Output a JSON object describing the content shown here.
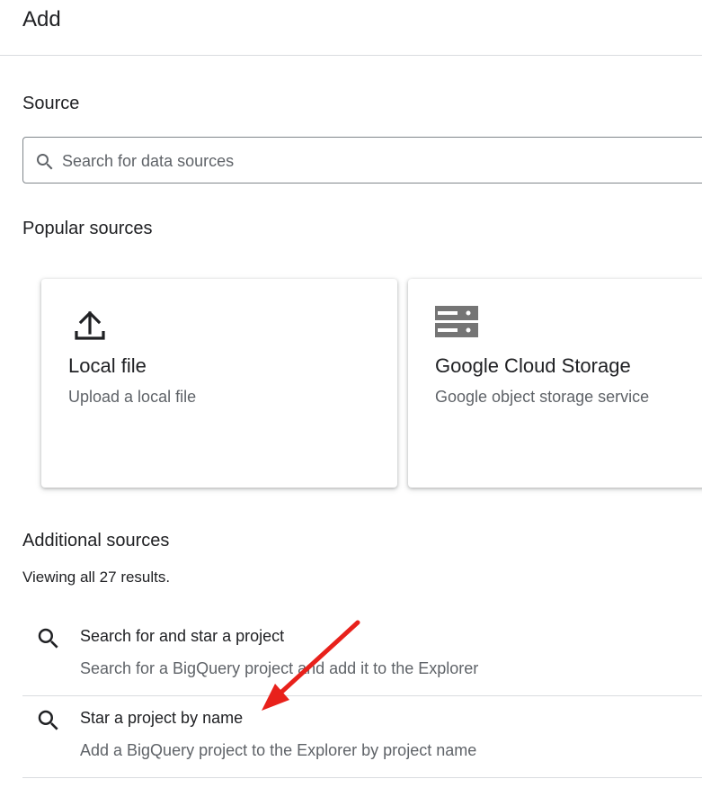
{
  "header": {
    "title": "Add"
  },
  "source": {
    "heading": "Source",
    "search": {
      "placeholder": "Search for data sources",
      "value": "",
      "icon": "search-icon"
    }
  },
  "popular": {
    "heading": "Popular sources",
    "cards": [
      {
        "icon": "upload-icon",
        "title": "Local file",
        "description": "Upload a local file"
      },
      {
        "icon": "storage-icon",
        "title": "Google Cloud Storage",
        "description": "Google object storage service"
      }
    ]
  },
  "additional": {
    "heading": "Additional sources",
    "count_text": "Viewing all 27 results.",
    "items": [
      {
        "icon": "search-icon",
        "title": "Search for and star a project",
        "description": "Search for a BigQuery project and add it to the Explorer"
      },
      {
        "icon": "search-icon",
        "title": "Star a project by name",
        "description": "Add a BigQuery project to the Explorer by project name"
      }
    ]
  },
  "annotation": {
    "icon": "red-arrow-icon",
    "color": "#e8211b"
  }
}
